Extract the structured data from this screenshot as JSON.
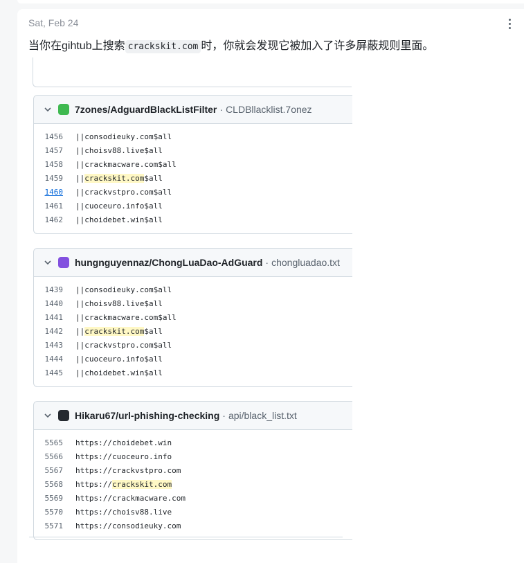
{
  "post": {
    "date": "Sat, Feb 24",
    "message_before": "当你在gihtub上搜索",
    "message_code": "crackskit.com",
    "message_after": "时，你就会发现它被加入了许多屏蔽规则里面。"
  },
  "cards": [
    {
      "repo": "7zones/AdguardBlackListFilter",
      "sep": "·",
      "file": "CLDBllacklist.7onez",
      "avatar_color": "#3fb950",
      "lines": [
        {
          "num": "1456",
          "pre": "||consodieuky.com$all",
          "hl": "",
          "post": ""
        },
        {
          "num": "1457",
          "pre": "||choisv88.live$all",
          "hl": "",
          "post": ""
        },
        {
          "num": "1458",
          "pre": "||crackmacware.com$all",
          "hl": "",
          "post": ""
        },
        {
          "num": "1459",
          "pre": "||",
          "hl": "crackskit.com",
          "post": "$all"
        },
        {
          "num": "1460",
          "pre": "||crackvstpro.com$all",
          "hl": "",
          "post": ""
        },
        {
          "num": "1461",
          "pre": "||cuoceuro.info$all",
          "hl": "",
          "post": ""
        },
        {
          "num": "1462",
          "pre": "||choidebet.win$all",
          "hl": "",
          "post": ""
        }
      ]
    },
    {
      "repo": "hungnguyennaz/ChongLuaDao-AdGuard",
      "sep": "·",
      "file": "chongluadao.txt",
      "avatar_color": "#8250df",
      "lines": [
        {
          "num": "1439",
          "pre": "||consodieuky.com$all",
          "hl": "",
          "post": ""
        },
        {
          "num": "1440",
          "pre": "||choisv88.live$all",
          "hl": "",
          "post": ""
        },
        {
          "num": "1441",
          "pre": "||crackmacware.com$all",
          "hl": "",
          "post": ""
        },
        {
          "num": "1442",
          "pre": "||",
          "hl": "crackskit.com",
          "post": "$all"
        },
        {
          "num": "1443",
          "pre": "||crackvstpro.com$all",
          "hl": "",
          "post": ""
        },
        {
          "num": "1444",
          "pre": "||cuoceuro.info$all",
          "hl": "",
          "post": ""
        },
        {
          "num": "1445",
          "pre": "||choidebet.win$all",
          "hl": "",
          "post": ""
        }
      ]
    },
    {
      "repo": "Hikaru67/url-phishing-checking",
      "sep": "·",
      "file": "api/black_list.txt",
      "avatar_color": "#24292f",
      "lines": [
        {
          "num": "5565",
          "pre": "https://choidebet.win",
          "hl": "",
          "post": ""
        },
        {
          "num": "5566",
          "pre": "https://cuoceuro.info",
          "hl": "",
          "post": ""
        },
        {
          "num": "5567",
          "pre": "https://crackvstpro.com",
          "hl": "",
          "post": ""
        },
        {
          "num": "5568",
          "pre": "https://",
          "hl": "crackskit.com",
          "post": ""
        },
        {
          "num": "5569",
          "pre": "https://crackmacware.com",
          "hl": "",
          "post": ""
        },
        {
          "num": "5570",
          "pre": "https://choisv88.live",
          "hl": "",
          "post": ""
        },
        {
          "num": "5571",
          "pre": "https://consodieuky.com",
          "hl": "",
          "post": ""
        }
      ]
    }
  ],
  "icons": {
    "kebab": "kebab-menu-icon",
    "chevron": "chevron-down-icon"
  },
  "colors": {
    "highlight": "#fff8c5",
    "link": "#0969da"
  }
}
